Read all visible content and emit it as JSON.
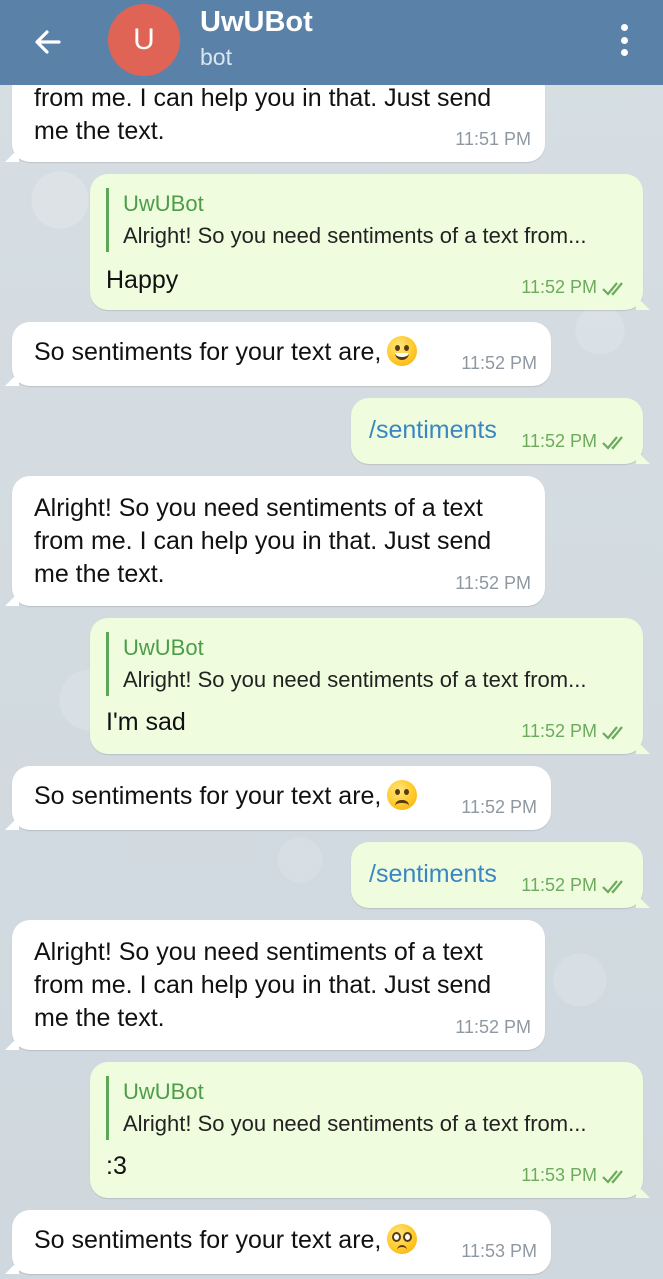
{
  "header": {
    "title": "UwUBot",
    "subtitle": "bot",
    "avatar_letter": "U",
    "avatar_color": "#e06456",
    "bar_color": "#5a82a8",
    "back_icon": "arrow-left-icon",
    "menu_icon": "more-vertical-icon"
  },
  "messages": [
    {
      "side": "in",
      "text": "from me. I can help you in that. Just send\nme the text.",
      "time": "11:51 PM"
    },
    {
      "side": "out",
      "quote_name": "UwUBot",
      "quote_text": "Alright! So you need sentiments of a text from...",
      "text": "Happy",
      "time": "11:52 PM"
    },
    {
      "side": "in",
      "text": "So sentiments for your text are,",
      "emoji": "grinning-face",
      "time": "11:52 PM"
    },
    {
      "side": "out",
      "text": "/sentiments",
      "time": "11:52 PM"
    },
    {
      "side": "in",
      "text": "Alright! So you need sentiments of a text\nfrom me. I can help you in that. Just send\nme the text.",
      "time": "11:52 PM"
    },
    {
      "side": "out",
      "quote_name": "UwUBot",
      "quote_text": "Alright! So you need sentiments of a text from...",
      "text": "I'm sad",
      "time": "11:52 PM"
    },
    {
      "side": "in",
      "text": "So sentiments for your text are,",
      "emoji": "frowning-face",
      "time": "11:52 PM"
    },
    {
      "side": "out",
      "text": "/sentiments",
      "time": "11:52 PM"
    },
    {
      "side": "in",
      "text": "Alright! So you need sentiments of a text\nfrom me. I can help you in that. Just send\nme the text.",
      "time": "11:52 PM"
    },
    {
      "side": "out",
      "quote_name": "UwUBot",
      "quote_text": "Alright! So you need sentiments of a text from...",
      "text": ":3",
      "time": "11:53 PM"
    },
    {
      "side": "in",
      "text": "So sentiments for your text are,",
      "emoji": "pleading-face",
      "time": "11:53 PM"
    }
  ]
}
